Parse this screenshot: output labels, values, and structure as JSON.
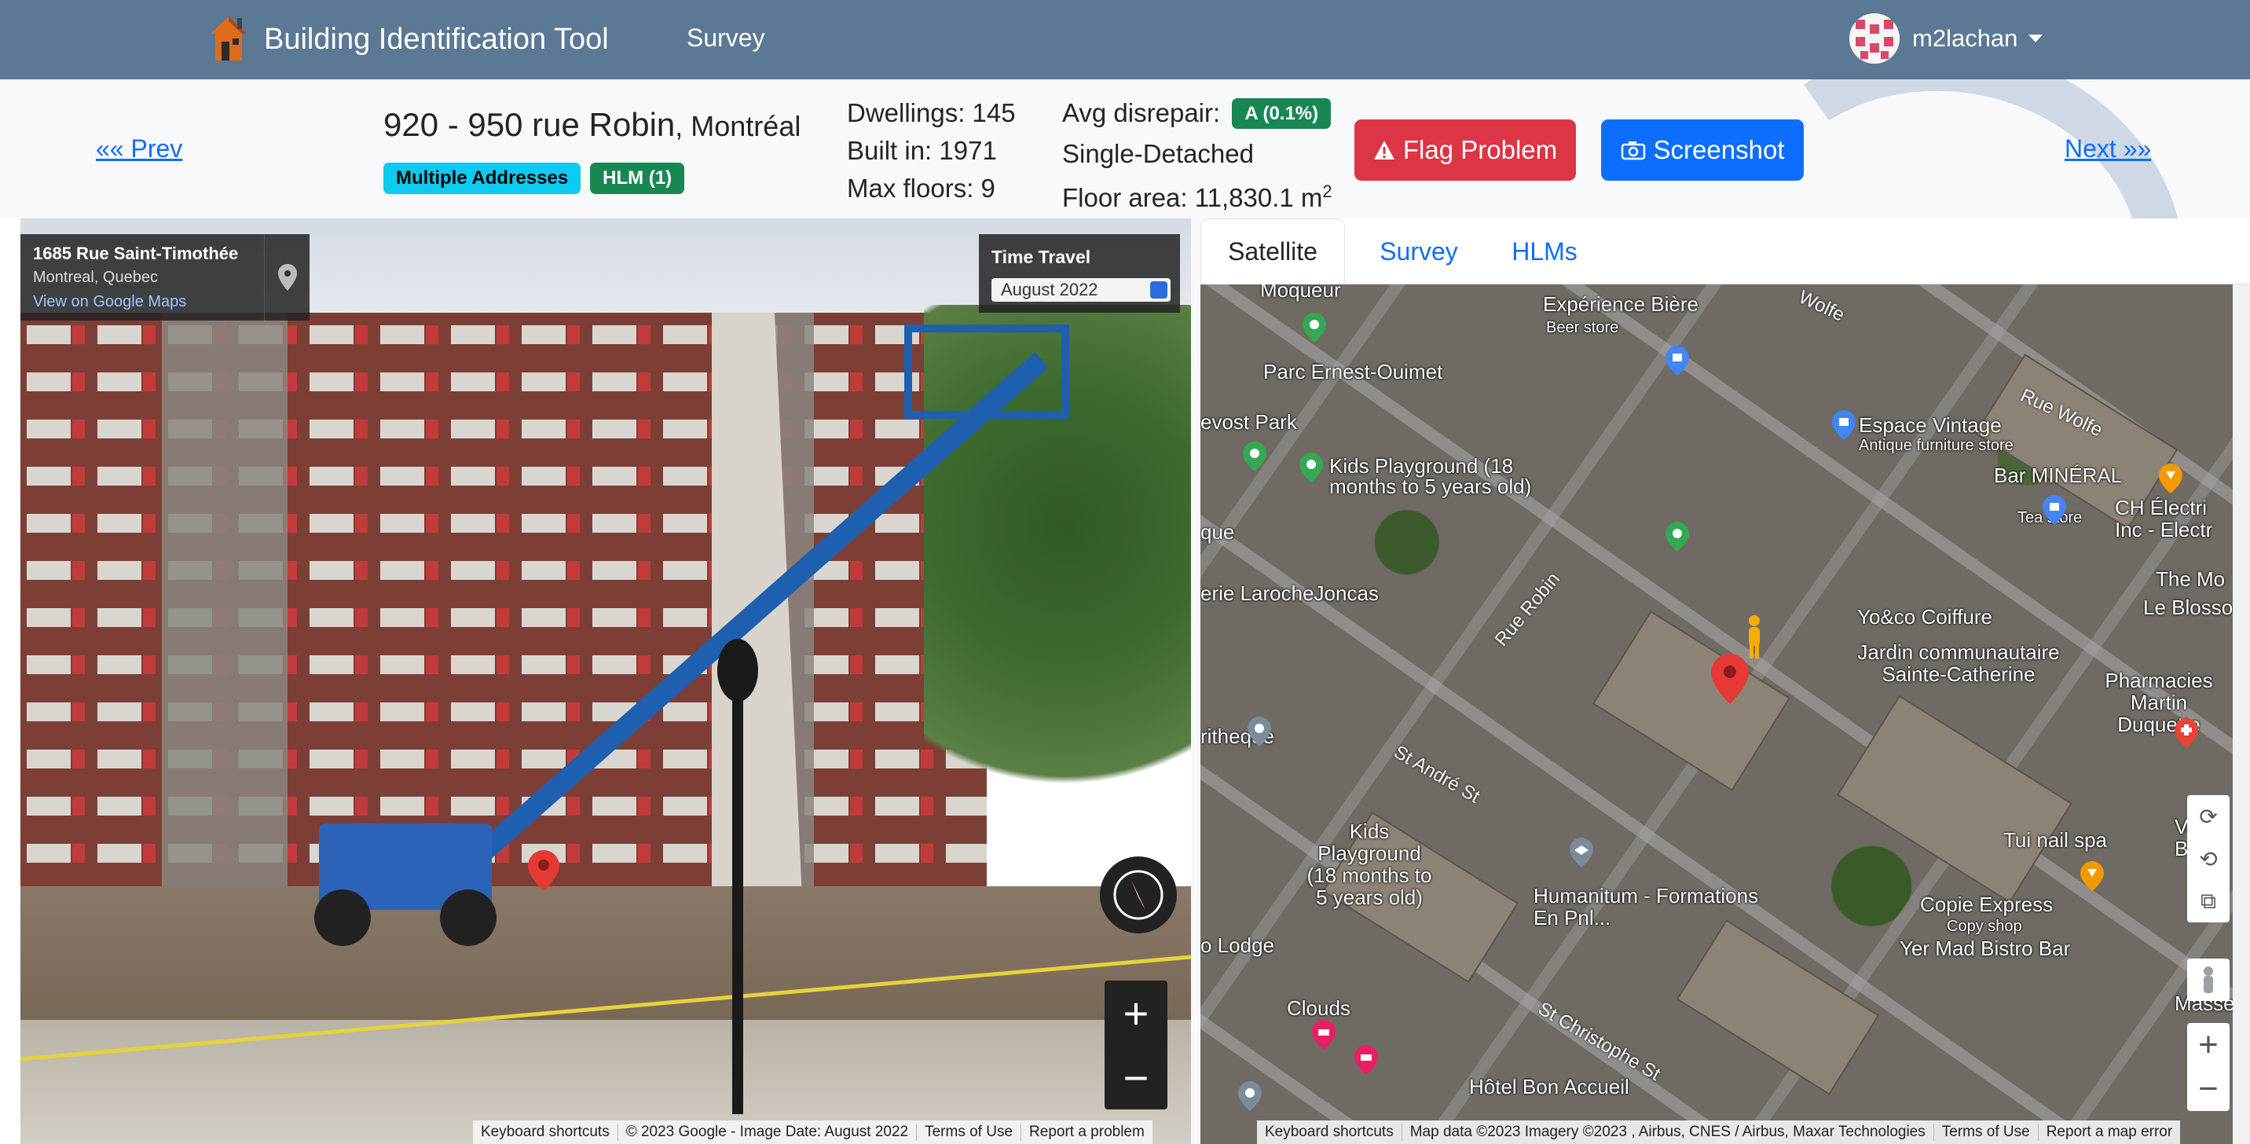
{
  "navbar": {
    "brand": "Building Identification Tool",
    "nav_survey": "Survey",
    "username": "m2lachan"
  },
  "building": {
    "address": "920 - 950 rue Robin",
    "city": ", Montréal",
    "badges": [
      "Multiple Addresses",
      "HLM (1)"
    ],
    "dwellings": "Dwellings: 145",
    "built_in": "Built in: 1971",
    "max_floors": "Max floors: 9",
    "avg_disrepair_label": "Avg disrepair:",
    "avg_disrepair_value": "A (0.1%)",
    "type": "Single-Detached",
    "floor_area_label": "Floor area: 11,830.1 m",
    "floor_area_unit_sup": "2"
  },
  "pager": {
    "prev": "«« Prev",
    "next": "Next »»"
  },
  "actions": {
    "flag": "Flag Problem",
    "screenshot": "Screenshot"
  },
  "colors": {
    "navbar": "#5b7894",
    "flag": "#dc3545",
    "screenshot": "#0d6efd",
    "green_badge": "#198754",
    "cyan_badge": "#0dcaf0"
  },
  "streetview": {
    "location_title": "1685 Rue Saint-Timothée",
    "location_sub": "Montreal, Quebec",
    "maps_link": "View on Google Maps",
    "time_travel_label": "Time Travel",
    "time_travel_value": "August 2022",
    "zoom_in": "+",
    "zoom_out": "−",
    "attribution": [
      "Keyboard shortcuts",
      "© 2023 Google - Image Date: August 2022",
      "Terms of Use",
      "Report a problem"
    ]
  },
  "tabs": [
    "Satellite",
    "Survey",
    "HLMs"
  ],
  "map": {
    "labels": [
      "Moqueur",
      "Expérience Bière",
      "Beer store",
      "Parc Ernest-Ouimet",
      "evost Park",
      "Kids Playground (18 months to 5 years old)",
      "que",
      "erie LarocheJoncas",
      "Rue Robin",
      "ritheque",
      "Espace Vintage",
      "Antique furniture store",
      "Rue Wolfe",
      "Bar MINÉRAL",
      "Tea store",
      "CH Électri Inc - Electr",
      "The Mo",
      "Le Blosso",
      "Yo&co Coiffure",
      "Jardin communautaire Sainte-Catherine",
      "Pharmacies Martin Duquette",
      "St André St",
      "Kids Playground (18 months to 5 years old)",
      "Humanitum - Formations En Pnl...",
      "Tui nail spa",
      "Vacc Berri",
      "Copie Express",
      "Copy shop",
      "Yer Mad Bistro Bar",
      "o Lodge",
      "Clouds",
      "St Christophe St",
      "Hôtel Bon Accueil",
      "Wolfe",
      "Masse"
    ],
    "zoom_in": "+",
    "zoom_out": "−",
    "attribution": [
      "Keyboard shortcuts",
      "Map data ©2023 Imagery ©2023 , Airbus, CNES / Airbus, Maxar Technologies",
      "Terms of Use",
      "Report a map error"
    ]
  }
}
